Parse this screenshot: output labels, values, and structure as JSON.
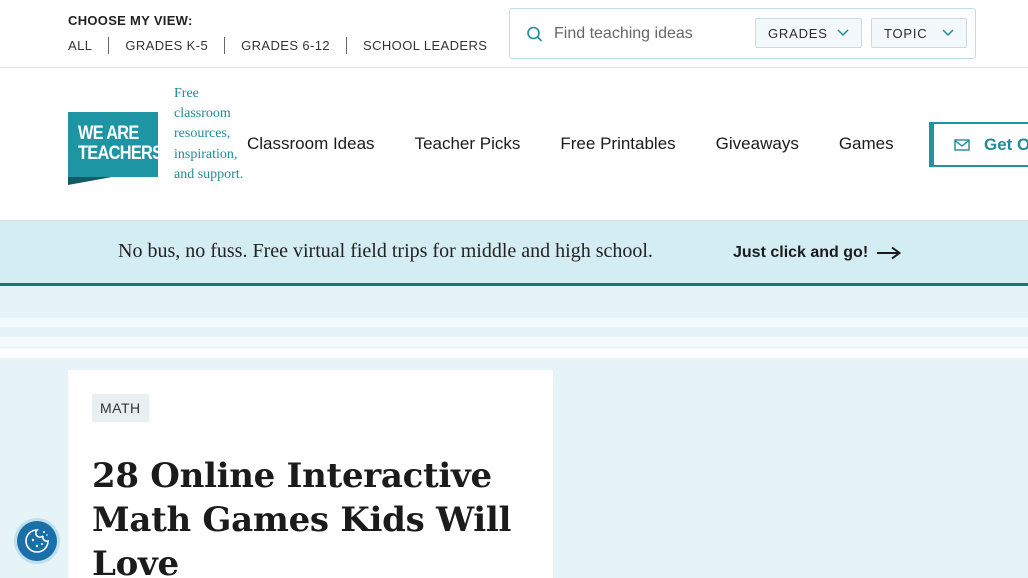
{
  "topbar": {
    "view_label": "CHOOSE MY VIEW:",
    "view_links": [
      "ALL",
      "GRADES K-5",
      "GRADES 6-12",
      "SCHOOL LEADERS"
    ],
    "search_placeholder": "Find teaching ideas",
    "filters": {
      "grades": "GRADES",
      "topic": "TOPIC"
    }
  },
  "brand": {
    "logo_line1": "WE ARE",
    "logo_line2": "TEACHERS",
    "tagline": "Free classroom resources, inspiration, and support.",
    "accent_color": "#1e95a3"
  },
  "nav": {
    "items": [
      "Classroom Ideas",
      "Teacher Picks",
      "Free Printables",
      "Giveaways",
      "Games"
    ],
    "cta_label": "Get Ou"
  },
  "promo": {
    "text": "No bus, no fuss. Free virtual field trips for middle and high school.",
    "link": "Just click and go!"
  },
  "article": {
    "tag": "MATH",
    "title": "28 Online Interactive Math Games Kids Will Love"
  },
  "icons": [
    "search-icon",
    "chevron-down-icon",
    "mail-icon",
    "arrow-right-icon",
    "cookie-icon"
  ]
}
